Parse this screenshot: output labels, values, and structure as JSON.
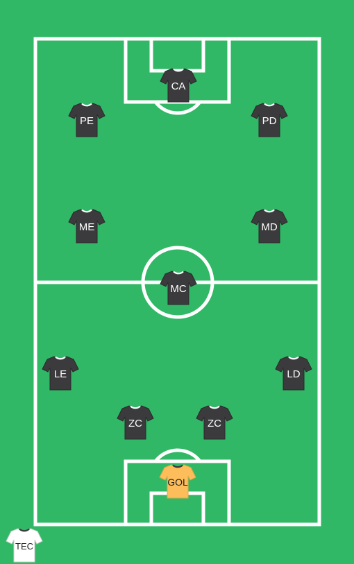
{
  "colors": {
    "grass": "#31b866",
    "lines": "#ffffff",
    "outfield_shirt": "#3b3a3c",
    "keeper_shirt": "#fdbd5a",
    "coach_shirt": "#ffffff"
  },
  "players": {
    "ca": {
      "label": "CA"
    },
    "pe": {
      "label": "PE"
    },
    "pd": {
      "label": "PD"
    },
    "me": {
      "label": "ME"
    },
    "md": {
      "label": "MD"
    },
    "mc": {
      "label": "MC"
    },
    "le": {
      "label": "LE"
    },
    "ld": {
      "label": "LD"
    },
    "zc1": {
      "label": "ZC"
    },
    "zc2": {
      "label": "ZC"
    },
    "gol": {
      "label": "GOL"
    }
  },
  "coach": {
    "label": "TEC"
  }
}
